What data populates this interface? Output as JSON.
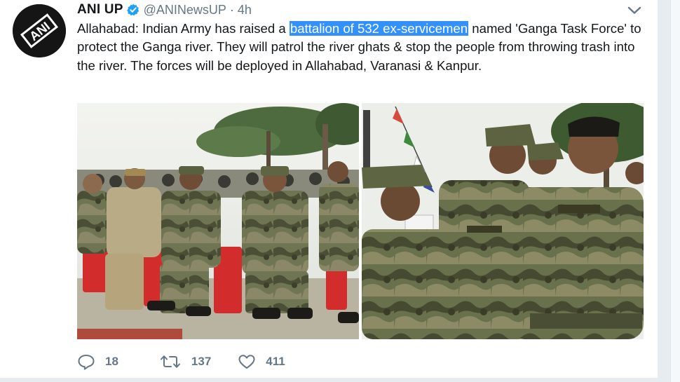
{
  "tweet": {
    "author_name": "ANI UP",
    "handle": "@ANINewsUP",
    "separator": "·",
    "time": "4h",
    "text_before": "Allahabad: Indian Army has raised a ",
    "text_highlight": "battalion of 532 ex-servicemen",
    "text_after": " named 'Ganga Task Force' to protect the Ganga river. They will patrol the river ghats & stop the people from throwing trash into the river. The forces will be deployed in Allahabad, Varanasi & Kanpur."
  },
  "avatar": {
    "logo_text": "ANI",
    "icon": "ani-logo"
  },
  "actions": {
    "reply_count": "18",
    "retweet_count": "137",
    "like_count": "411"
  },
  "colors": {
    "text": "#14171a",
    "secondary": "#657786",
    "verified": "#1da1f2",
    "selection": "#3390ff"
  }
}
